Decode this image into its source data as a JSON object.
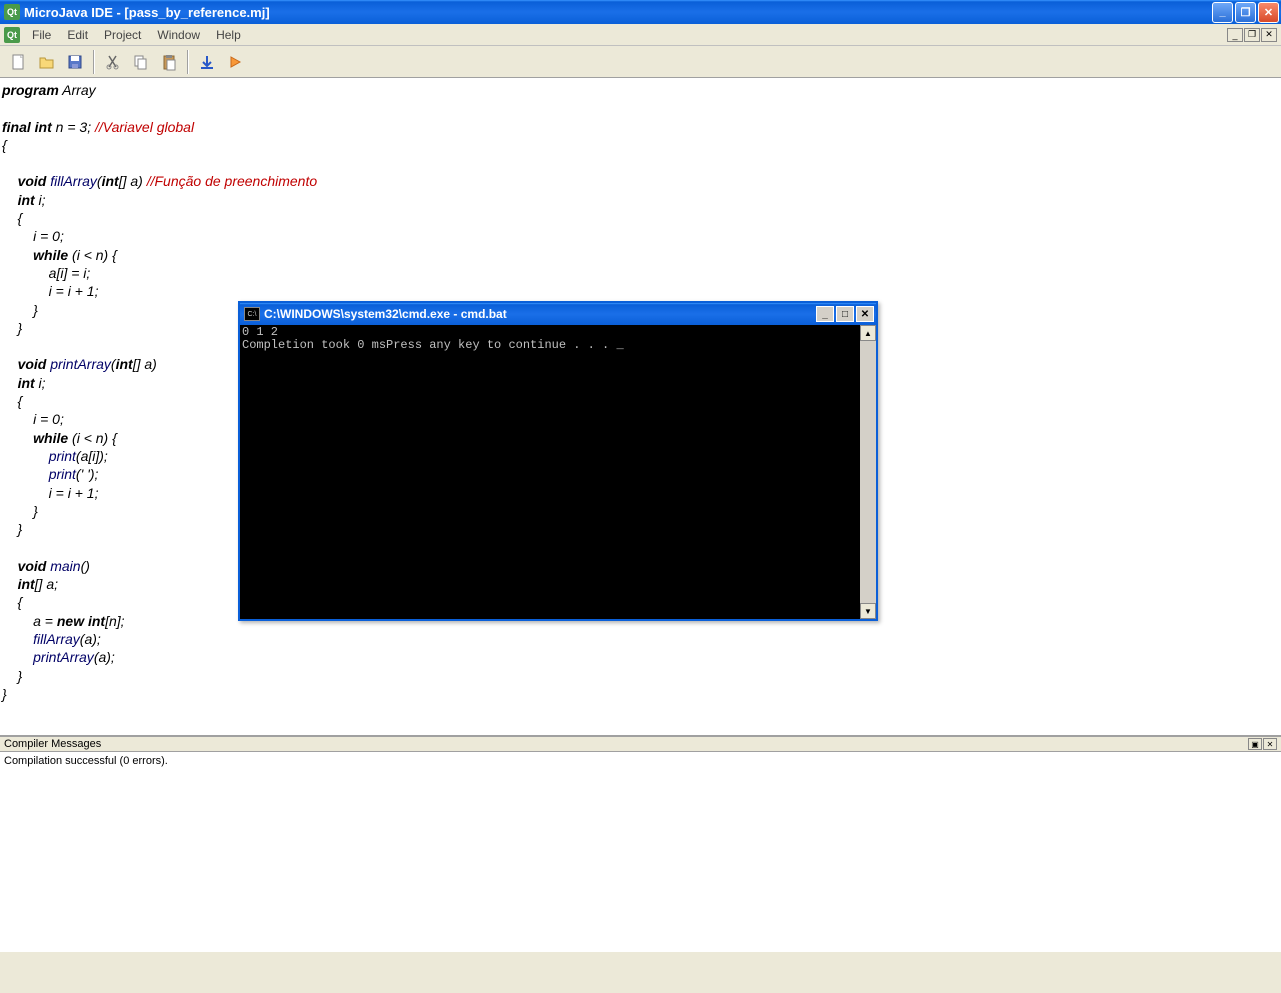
{
  "window": {
    "title": "MicroJava IDE - [pass_by_reference.mj]"
  },
  "menu": {
    "file": "File",
    "edit": "Edit",
    "project": "Project",
    "window": "Window",
    "help": "Help"
  },
  "code": {
    "l1_kw": "program",
    "l1_rest": " Array",
    "l3a": "final int",
    "l3b": " n = 3; ",
    "l3c": "//Variavel global",
    "l4": "{",
    "l6i": "    ",
    "l6a": "void",
    "l6b": " ",
    "l6fn": "fillArray",
    "l6c": "(",
    "l6d": "int",
    "l6e": "[] a) ",
    "l6cm": "//Função de preenchimento",
    "l7i": "    ",
    "l7a": "int",
    "l7b": " i;",
    "l8": "    {",
    "l9": "        i = 0;",
    "l10i": "        ",
    "l10a": "while",
    "l10b": " (i < n) {",
    "l11": "            a[i] = i;",
    "l12": "            i = i + 1;",
    "l13": "        }",
    "l14": "    }",
    "l16i": "    ",
    "l16a": "void",
    "l16b": " ",
    "l16fn": "printArray",
    "l16c": "(",
    "l16d": "int",
    "l16e": "[] a)",
    "l17i": "    ",
    "l17a": "int",
    "l17b": " i;",
    "l18": "    {",
    "l19": "        i = 0;",
    "l20i": "        ",
    "l20a": "while",
    "l20b": " (i < n) {",
    "l21i": "            ",
    "l21fn": "print",
    "l21b": "(a[i]);",
    "l22i": "            ",
    "l22fn": "print",
    "l22b": "(' ');",
    "l23": "            i = i + 1;",
    "l24": "        }",
    "l25": "    }",
    "l27i": "    ",
    "l27a": "void",
    "l27b": " ",
    "l27fn": "main",
    "l27c": "()",
    "l28i": "    ",
    "l28a": "int",
    "l28b": "[] a;",
    "l29": "    {",
    "l30i": "        a = ",
    "l30a": "new int",
    "l30b": "[n];",
    "l31i": "        ",
    "l31fn": "fillArray",
    "l31b": "(a);",
    "l32i": "        ",
    "l32fn": "printArray",
    "l32b": "(a);",
    "l33": "    }",
    "l34": "}"
  },
  "compiler": {
    "title": "Compiler Messages",
    "message": "Compilation successful (0 errors)."
  },
  "cmd": {
    "title": "C:\\WINDOWS\\system32\\cmd.exe - cmd.bat",
    "line1": "0 1 2 ",
    "line2": "Completion took 0 msPress any key to continue . . . _"
  }
}
